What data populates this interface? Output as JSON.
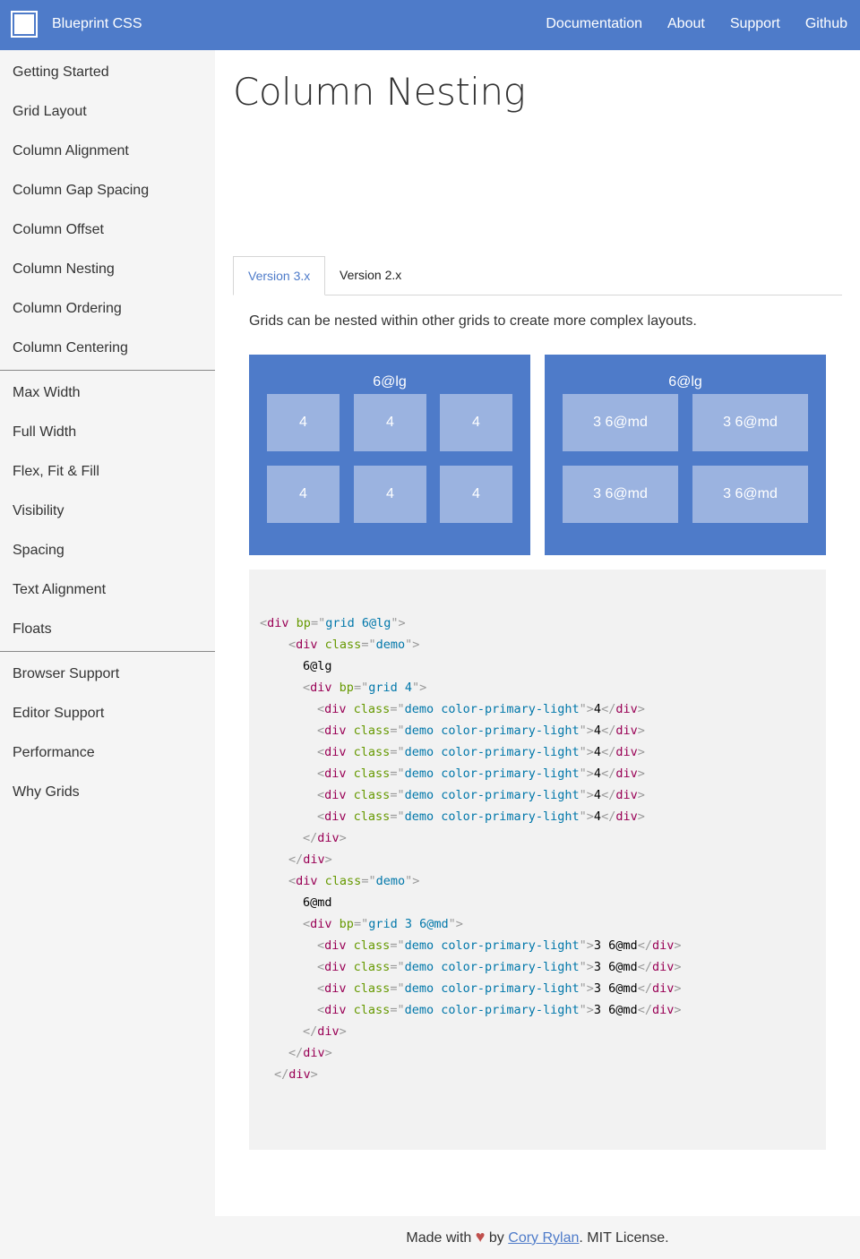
{
  "header": {
    "brand": "Blueprint CSS",
    "nav": [
      "Documentation",
      "About",
      "Support",
      "Github"
    ]
  },
  "sidebar": {
    "groups": [
      [
        "Getting Started",
        "Grid Layout",
        "Column Alignment",
        "Column Gap Spacing",
        "Column Offset",
        "Column Nesting",
        "Column Ordering",
        "Column Centering"
      ],
      [
        "Max Width",
        "Full Width",
        "Flex, Fit & Fill",
        "Visibility",
        "Spacing",
        "Text Alignment",
        "Floats"
      ],
      [
        "Browser Support",
        "Editor Support",
        "Performance",
        "Why Grids"
      ]
    ]
  },
  "main": {
    "title": "Column Nesting",
    "tabs": [
      {
        "label": "Version 3.x",
        "active": true
      },
      {
        "label": "Version 2.x",
        "active": false
      }
    ],
    "intro": "Grids can be nested within other grids to create more complex layouts.",
    "demo_left": {
      "title": "6@lg",
      "cells": [
        "4",
        "4",
        "4",
        "4",
        "4",
        "4"
      ]
    },
    "demo_right": {
      "title": "6@lg",
      "cells": [
        "3 6@md",
        "3 6@md",
        "3 6@md",
        "3 6@md"
      ]
    },
    "code_lines": [
      {
        "indent": 0,
        "tokens": [
          [
            "punc",
            "<"
          ],
          [
            "tag",
            "div"
          ],
          [
            "text",
            " "
          ],
          [
            "attr",
            "bp"
          ],
          [
            "punc",
            "=\""
          ],
          [
            "val",
            "grid 6@lg"
          ],
          [
            "punc",
            "\">"
          ]
        ]
      },
      {
        "indent": 4,
        "tokens": [
          [
            "punc",
            "<"
          ],
          [
            "tag",
            "div"
          ],
          [
            "text",
            " "
          ],
          [
            "attr",
            "class"
          ],
          [
            "punc",
            "=\""
          ],
          [
            "val",
            "demo"
          ],
          [
            "punc",
            "\">"
          ]
        ]
      },
      {
        "indent": 6,
        "tokens": [
          [
            "text",
            "6@lg"
          ]
        ]
      },
      {
        "indent": 6,
        "tokens": [
          [
            "punc",
            "<"
          ],
          [
            "tag",
            "div"
          ],
          [
            "text",
            " "
          ],
          [
            "attr",
            "bp"
          ],
          [
            "punc",
            "=\""
          ],
          [
            "val",
            "grid 4"
          ],
          [
            "punc",
            "\">"
          ]
        ]
      },
      {
        "indent": 8,
        "tokens": [
          [
            "punc",
            "<"
          ],
          [
            "tag",
            "div"
          ],
          [
            "text",
            " "
          ],
          [
            "attr",
            "class"
          ],
          [
            "punc",
            "=\""
          ],
          [
            "val",
            "demo color-primary-light"
          ],
          [
            "punc",
            "\">"
          ],
          [
            "text",
            "4"
          ],
          [
            "punc",
            "</"
          ],
          [
            "tag",
            "div"
          ],
          [
            "punc",
            ">"
          ]
        ]
      },
      {
        "indent": 8,
        "tokens": [
          [
            "punc",
            "<"
          ],
          [
            "tag",
            "div"
          ],
          [
            "text",
            " "
          ],
          [
            "attr",
            "class"
          ],
          [
            "punc",
            "=\""
          ],
          [
            "val",
            "demo color-primary-light"
          ],
          [
            "punc",
            "\">"
          ],
          [
            "text",
            "4"
          ],
          [
            "punc",
            "</"
          ],
          [
            "tag",
            "div"
          ],
          [
            "punc",
            ">"
          ]
        ]
      },
      {
        "indent": 8,
        "tokens": [
          [
            "punc",
            "<"
          ],
          [
            "tag",
            "div"
          ],
          [
            "text",
            " "
          ],
          [
            "attr",
            "class"
          ],
          [
            "punc",
            "=\""
          ],
          [
            "val",
            "demo color-primary-light"
          ],
          [
            "punc",
            "\">"
          ],
          [
            "text",
            "4"
          ],
          [
            "punc",
            "</"
          ],
          [
            "tag",
            "div"
          ],
          [
            "punc",
            ">"
          ]
        ]
      },
      {
        "indent": 8,
        "tokens": [
          [
            "punc",
            "<"
          ],
          [
            "tag",
            "div"
          ],
          [
            "text",
            " "
          ],
          [
            "attr",
            "class"
          ],
          [
            "punc",
            "=\""
          ],
          [
            "val",
            "demo color-primary-light"
          ],
          [
            "punc",
            "\">"
          ],
          [
            "text",
            "4"
          ],
          [
            "punc",
            "</"
          ],
          [
            "tag",
            "div"
          ],
          [
            "punc",
            ">"
          ]
        ]
      },
      {
        "indent": 8,
        "tokens": [
          [
            "punc",
            "<"
          ],
          [
            "tag",
            "div"
          ],
          [
            "text",
            " "
          ],
          [
            "attr",
            "class"
          ],
          [
            "punc",
            "=\""
          ],
          [
            "val",
            "demo color-primary-light"
          ],
          [
            "punc",
            "\">"
          ],
          [
            "text",
            "4"
          ],
          [
            "punc",
            "</"
          ],
          [
            "tag",
            "div"
          ],
          [
            "punc",
            ">"
          ]
        ]
      },
      {
        "indent": 8,
        "tokens": [
          [
            "punc",
            "<"
          ],
          [
            "tag",
            "div"
          ],
          [
            "text",
            " "
          ],
          [
            "attr",
            "class"
          ],
          [
            "punc",
            "=\""
          ],
          [
            "val",
            "demo color-primary-light"
          ],
          [
            "punc",
            "\">"
          ],
          [
            "text",
            "4"
          ],
          [
            "punc",
            "</"
          ],
          [
            "tag",
            "div"
          ],
          [
            "punc",
            ">"
          ]
        ]
      },
      {
        "indent": 6,
        "tokens": [
          [
            "punc",
            "</"
          ],
          [
            "tag",
            "div"
          ],
          [
            "punc",
            ">"
          ]
        ]
      },
      {
        "indent": 4,
        "tokens": [
          [
            "punc",
            "</"
          ],
          [
            "tag",
            "div"
          ],
          [
            "punc",
            ">"
          ]
        ]
      },
      {
        "indent": 4,
        "tokens": [
          [
            "punc",
            "<"
          ],
          [
            "tag",
            "div"
          ],
          [
            "text",
            " "
          ],
          [
            "attr",
            "class"
          ],
          [
            "punc",
            "=\""
          ],
          [
            "val",
            "demo"
          ],
          [
            "punc",
            "\">"
          ]
        ]
      },
      {
        "indent": 6,
        "tokens": [
          [
            "text",
            "6@md"
          ]
        ]
      },
      {
        "indent": 6,
        "tokens": [
          [
            "punc",
            "<"
          ],
          [
            "tag",
            "div"
          ],
          [
            "text",
            " "
          ],
          [
            "attr",
            "bp"
          ],
          [
            "punc",
            "=\""
          ],
          [
            "val",
            "grid 3 6@md"
          ],
          [
            "punc",
            "\">"
          ]
        ]
      },
      {
        "indent": 8,
        "tokens": [
          [
            "punc",
            "<"
          ],
          [
            "tag",
            "div"
          ],
          [
            "text",
            " "
          ],
          [
            "attr",
            "class"
          ],
          [
            "punc",
            "=\""
          ],
          [
            "val",
            "demo color-primary-light"
          ],
          [
            "punc",
            "\">"
          ],
          [
            "text",
            "3 6@md"
          ],
          [
            "punc",
            "</"
          ],
          [
            "tag",
            "div"
          ],
          [
            "punc",
            ">"
          ]
        ]
      },
      {
        "indent": 8,
        "tokens": [
          [
            "punc",
            "<"
          ],
          [
            "tag",
            "div"
          ],
          [
            "text",
            " "
          ],
          [
            "attr",
            "class"
          ],
          [
            "punc",
            "=\""
          ],
          [
            "val",
            "demo color-primary-light"
          ],
          [
            "punc",
            "\">"
          ],
          [
            "text",
            "3 6@md"
          ],
          [
            "punc",
            "</"
          ],
          [
            "tag",
            "div"
          ],
          [
            "punc",
            ">"
          ]
        ]
      },
      {
        "indent": 8,
        "tokens": [
          [
            "punc",
            "<"
          ],
          [
            "tag",
            "div"
          ],
          [
            "text",
            " "
          ],
          [
            "attr",
            "class"
          ],
          [
            "punc",
            "=\""
          ],
          [
            "val",
            "demo color-primary-light"
          ],
          [
            "punc",
            "\">"
          ],
          [
            "text",
            "3 6@md"
          ],
          [
            "punc",
            "</"
          ],
          [
            "tag",
            "div"
          ],
          [
            "punc",
            ">"
          ]
        ]
      },
      {
        "indent": 8,
        "tokens": [
          [
            "punc",
            "<"
          ],
          [
            "tag",
            "div"
          ],
          [
            "text",
            " "
          ],
          [
            "attr",
            "class"
          ],
          [
            "punc",
            "=\""
          ],
          [
            "val",
            "demo color-primary-light"
          ],
          [
            "punc",
            "\">"
          ],
          [
            "text",
            "3 6@md"
          ],
          [
            "punc",
            "</"
          ],
          [
            "tag",
            "div"
          ],
          [
            "punc",
            ">"
          ]
        ]
      },
      {
        "indent": 6,
        "tokens": [
          [
            "punc",
            "</"
          ],
          [
            "tag",
            "div"
          ],
          [
            "punc",
            ">"
          ]
        ]
      },
      {
        "indent": 4,
        "tokens": [
          [
            "punc",
            "</"
          ],
          [
            "tag",
            "div"
          ],
          [
            "punc",
            ">"
          ]
        ]
      },
      {
        "indent": 2,
        "tokens": [
          [
            "punc",
            "</"
          ],
          [
            "tag",
            "div"
          ],
          [
            "punc",
            ">"
          ]
        ]
      }
    ]
  },
  "footer": {
    "made_with": "Made with",
    "heart_icon": "heart-icon",
    "by": "by",
    "author": "Cory Rylan",
    "license": ". MIT License."
  },
  "colors": {
    "primary": "#4e7bc9",
    "primary_light": "#9bb3e0",
    "heart": "#c0504d"
  }
}
